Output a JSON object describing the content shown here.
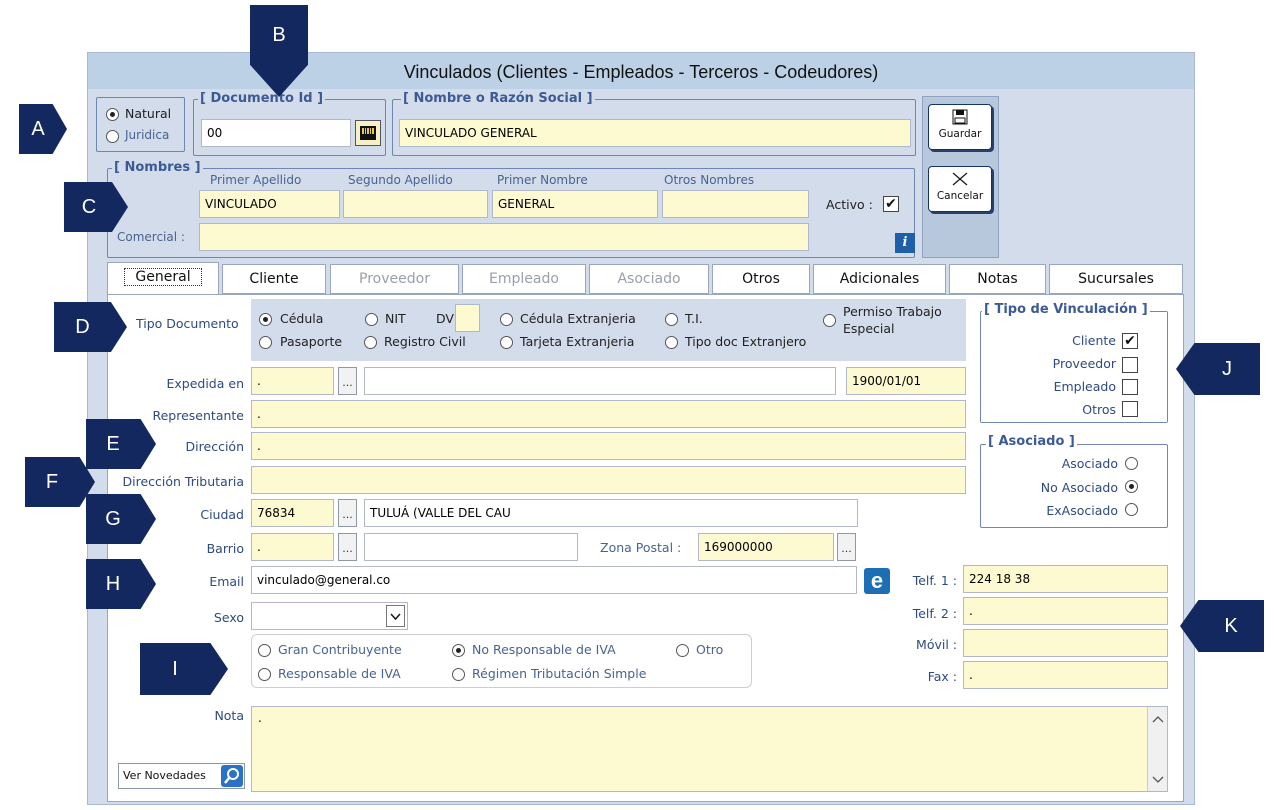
{
  "window": {
    "title": "Vinculados    (Clientes - Empleados - Terceros - Codeudores)"
  },
  "callouts": [
    "A",
    "B",
    "C",
    "D",
    "E",
    "F",
    "G",
    "H",
    "I",
    "J",
    "K"
  ],
  "persona": {
    "natural": "Natural",
    "juridica": "Juridica",
    "selected": "Natural"
  },
  "documento": {
    "legend": "[ Documento Id ]",
    "value": "00",
    "icon": "barcode-icon"
  },
  "razon_social": {
    "legend": "[ Nombre o Razón Social ]",
    "value": "VINCULADO GENERAL"
  },
  "buttons": {
    "guardar": "Guardar",
    "cancelar": "Cancelar",
    "ver_novedades": "Ver Novedades"
  },
  "nombres": {
    "legend": "[ Nombres ]",
    "primer_apellido_label": "Primer Apellido",
    "primer_apellido": "VINCULADO",
    "segundo_apellido_label": "Segundo Apellido",
    "segundo_apellido": "",
    "primer_nombre_label": "Primer Nombre",
    "primer_nombre": "GENERAL",
    "otros_nombres_label": "Otros Nombres",
    "otros_nombres": "",
    "comercial_label": "Comercial :",
    "comercial": "",
    "activo_label": "Activo :",
    "activo": true
  },
  "tabs": [
    "General",
    "Cliente",
    "Proveedor",
    "Empleado",
    "Asociado",
    "Otros",
    "Adicionales",
    "Notas",
    "Sucursales"
  ],
  "tipo_documento": {
    "label": "Tipo Documento",
    "options": [
      "Cédula",
      "NIT",
      "DV",
      "Cédula Extranjeria",
      "T.I.",
      "Permiso Trabajo",
      "Especial",
      "Pasaporte",
      "Registro Civil",
      "Tarjeta Extranjeria",
      "Tipo doc Extranjero"
    ],
    "selected": "Cédula"
  },
  "form": {
    "expedida_label": "Expedida en",
    "expedida_code": ".",
    "expedida_name": "",
    "fecha": "1900/01/01",
    "representante_label": "Representante",
    "representante": ".",
    "direccion_label": "Dirección",
    "direccion": ".",
    "direccion_trib_label": "Dirección Tributaria",
    "direccion_trib": "",
    "ciudad_label": "Ciudad",
    "ciudad_code": "76834",
    "ciudad_name": "TULUÁ (VALLE DEL CAU",
    "barrio_label": "Barrio",
    "barrio_code": ".",
    "barrio_name": "",
    "zona_postal_label": "Zona Postal :",
    "zona_postal": "169000000",
    "email_label": "Email",
    "email": "vinculado@general.co",
    "sexo_label": "Sexo",
    "sexo": "",
    "nota_label": "Nota",
    "nota": "."
  },
  "regimen": {
    "options": [
      "Gran Contribuyente",
      "No Responsable de IVA",
      "Otro",
      "Responsable de IVA",
      "Régimen Tributación Simple"
    ],
    "selected": "No Responsable de IVA"
  },
  "telefonos": {
    "telf1_label": "Telf. 1 :",
    "telf1": "224 18 38",
    "telf2_label": "Telf. 2 :",
    "telf2": ".",
    "movil_label": "Móvil :",
    "movil": "",
    "fax_label": "Fax :",
    "fax": "."
  },
  "tipo_vinculacion": {
    "legend": "[ Tipo de Vinculación ]",
    "items": [
      {
        "label": "Cliente",
        "checked": true
      },
      {
        "label": "Proveedor",
        "checked": false
      },
      {
        "label": "Empleado",
        "checked": false
      },
      {
        "label": "Otros",
        "checked": false
      }
    ]
  },
  "asociado": {
    "legend": "[ Asociado ]",
    "options": [
      "Asociado",
      "No Asociado",
      "ExAsociado"
    ],
    "selected": "No Asociado"
  }
}
